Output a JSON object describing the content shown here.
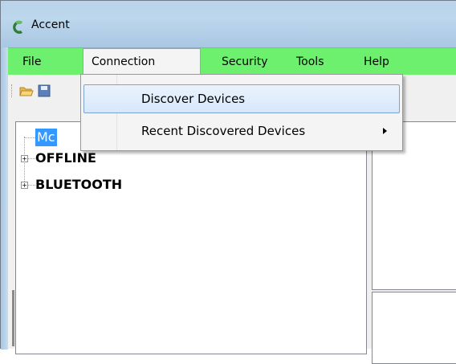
{
  "window": {
    "title": "Accent"
  },
  "colors": {
    "menubar": "#6df06e",
    "titlebar": "#b9d3ea",
    "selection": "#3399ff",
    "hover": "#d7e8fb"
  },
  "menubar": {
    "items": [
      {
        "label": "File"
      },
      {
        "label": "Connection"
      },
      {
        "label": "Security"
      },
      {
        "label": "Tools"
      },
      {
        "label": "Help"
      }
    ]
  },
  "toolbar": {
    "icons": [
      "open-folder-icon",
      "save-icon"
    ]
  },
  "connection_menu": {
    "items": [
      {
        "label": "Discover Devices"
      },
      {
        "label": "Recent Discovered Devices"
      }
    ]
  },
  "tree": {
    "nodes": [
      {
        "label": "Mc"
      },
      {
        "label": "OFFLINE"
      },
      {
        "label": "BLUETOOTH"
      }
    ]
  }
}
